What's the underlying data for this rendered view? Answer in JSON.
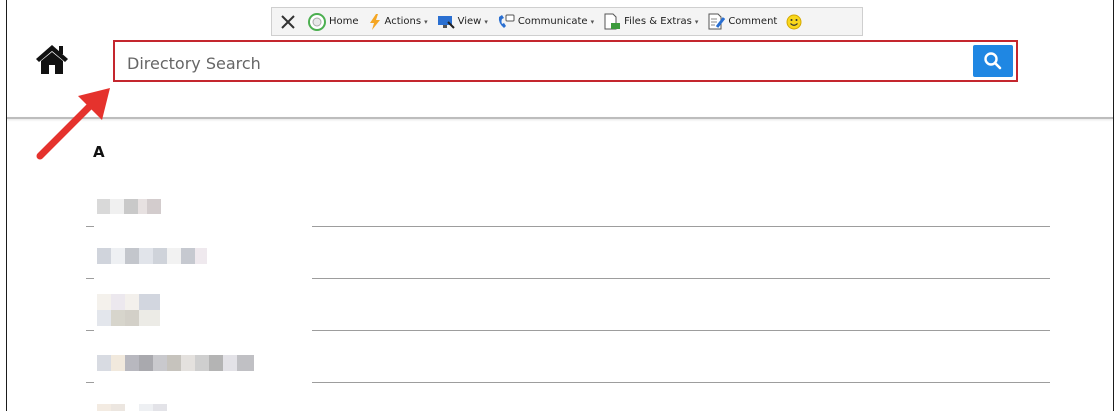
{
  "toolbar": {
    "items": [
      {
        "label": "",
        "icon": "close-icon"
      },
      {
        "label": "Home",
        "icon": "home-circle-icon"
      },
      {
        "label": "Actions",
        "icon": "lightning-icon",
        "dropdown": true
      },
      {
        "label": "View",
        "icon": "monitor-icon",
        "dropdown": true
      },
      {
        "label": "Communicate",
        "icon": "phone-chat-icon",
        "dropdown": true
      },
      {
        "label": "Files & Extras",
        "icon": "files-icon",
        "dropdown": true
      },
      {
        "label": "Comment",
        "icon": "comment-icon"
      },
      {
        "label": "",
        "icon": "smiley-icon"
      }
    ],
    "caret": "▾"
  },
  "search": {
    "placeholder": "Directory Search"
  },
  "directory": {
    "section_letter": "A",
    "entries": [
      {
        "name": ""
      },
      {
        "name": ""
      },
      {
        "name": ""
      },
      {
        "name": ""
      },
      {
        "name": ""
      }
    ]
  },
  "colors": {
    "search_border": "#c4262e",
    "search_button": "#1f87e3",
    "annotation_arrow": "#e5322d"
  }
}
